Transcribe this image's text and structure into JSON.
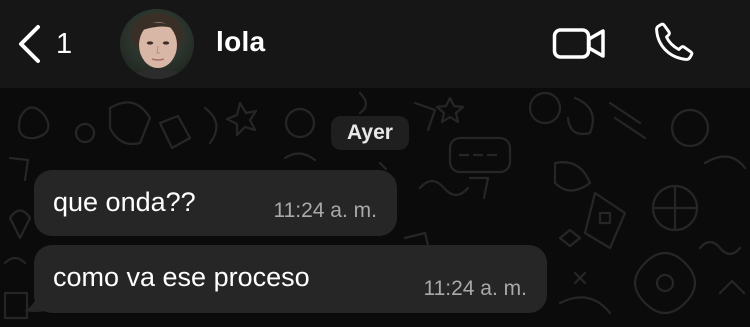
{
  "header": {
    "back_icon": "chevron-left-icon",
    "unread_count": "1",
    "contact_name": "lola",
    "video_icon": "video-camera-icon",
    "call_icon": "phone-icon"
  },
  "chat": {
    "date_separator": "Ayer",
    "messages": [
      {
        "text": "que onda??",
        "time": "11:24 a. m."
      },
      {
        "text": "como va ese proceso",
        "time": "11:24 a. m."
      }
    ]
  },
  "colors": {
    "header_bg": "#161616",
    "chat_bg": "#0b0b0b",
    "bubble_bg": "#262626",
    "time_text": "#a9a9a9"
  }
}
